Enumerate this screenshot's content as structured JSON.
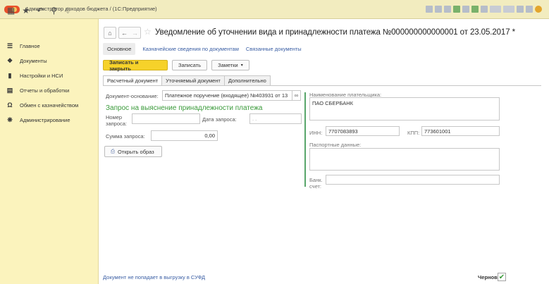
{
  "window": {
    "title": "Администратор доходов бюджета / (1С:Предприятие)"
  },
  "sidebar": {
    "items": [
      {
        "label": "Главное",
        "icon": "menu-lines-icon"
      },
      {
        "label": "Документы",
        "icon": "document-icon"
      },
      {
        "label": "Настройки и НСИ",
        "icon": "settings-icon"
      },
      {
        "label": "Отчеты и обработки",
        "icon": "report-icon"
      },
      {
        "label": "Обмен с казначейством",
        "icon": "exchange-icon"
      },
      {
        "label": "Администрирование",
        "icon": "gear-icon"
      }
    ]
  },
  "document": {
    "title": "Уведомление об уточнении вида и принадлежности платежа №000000000000001 от 23.05.2017 *",
    "subtabs": [
      "Основное",
      "Казначейские сведения по документам",
      "Связанные документы"
    ],
    "buttons": {
      "save_close": "Записать и закрыть",
      "save": "Записать",
      "notes": "Заметки"
    },
    "tabs": [
      "Расчетный документ",
      "Уточняемый документ",
      "Дополнительно"
    ]
  },
  "form": {
    "base_doc_label": "Документ-основание:",
    "base_doc_value": "Платежное поручение (входящее) №403931 от 13",
    "section_title": "Запрос на выяснение принадлежности платежа",
    "request_number_label": "Номер запроса:",
    "request_number_value": "",
    "request_date_label": "Дата запроса:",
    "request_date_value": ". .",
    "request_sum_label": "Сумма запроса:",
    "request_sum_value": "0,00",
    "open_image_button": "Открыть образ",
    "payer_name_label": "Наименование плательщика:",
    "payer_name_value": "ПАО СБЕРБАНК",
    "inn_label": "ИНН:",
    "inn_value": "7707083893",
    "kpp_label": "КПП:",
    "kpp_value": "773601001",
    "passport_label": "Паспортные данные:",
    "passport_value": "",
    "bank_account_label": "Банк. счет:",
    "bank_account_value": ""
  },
  "footer": {
    "note": "Документ не попадает в выгрузку в СУФД",
    "draft_label": "Черновик:",
    "draft_checked": true
  }
}
